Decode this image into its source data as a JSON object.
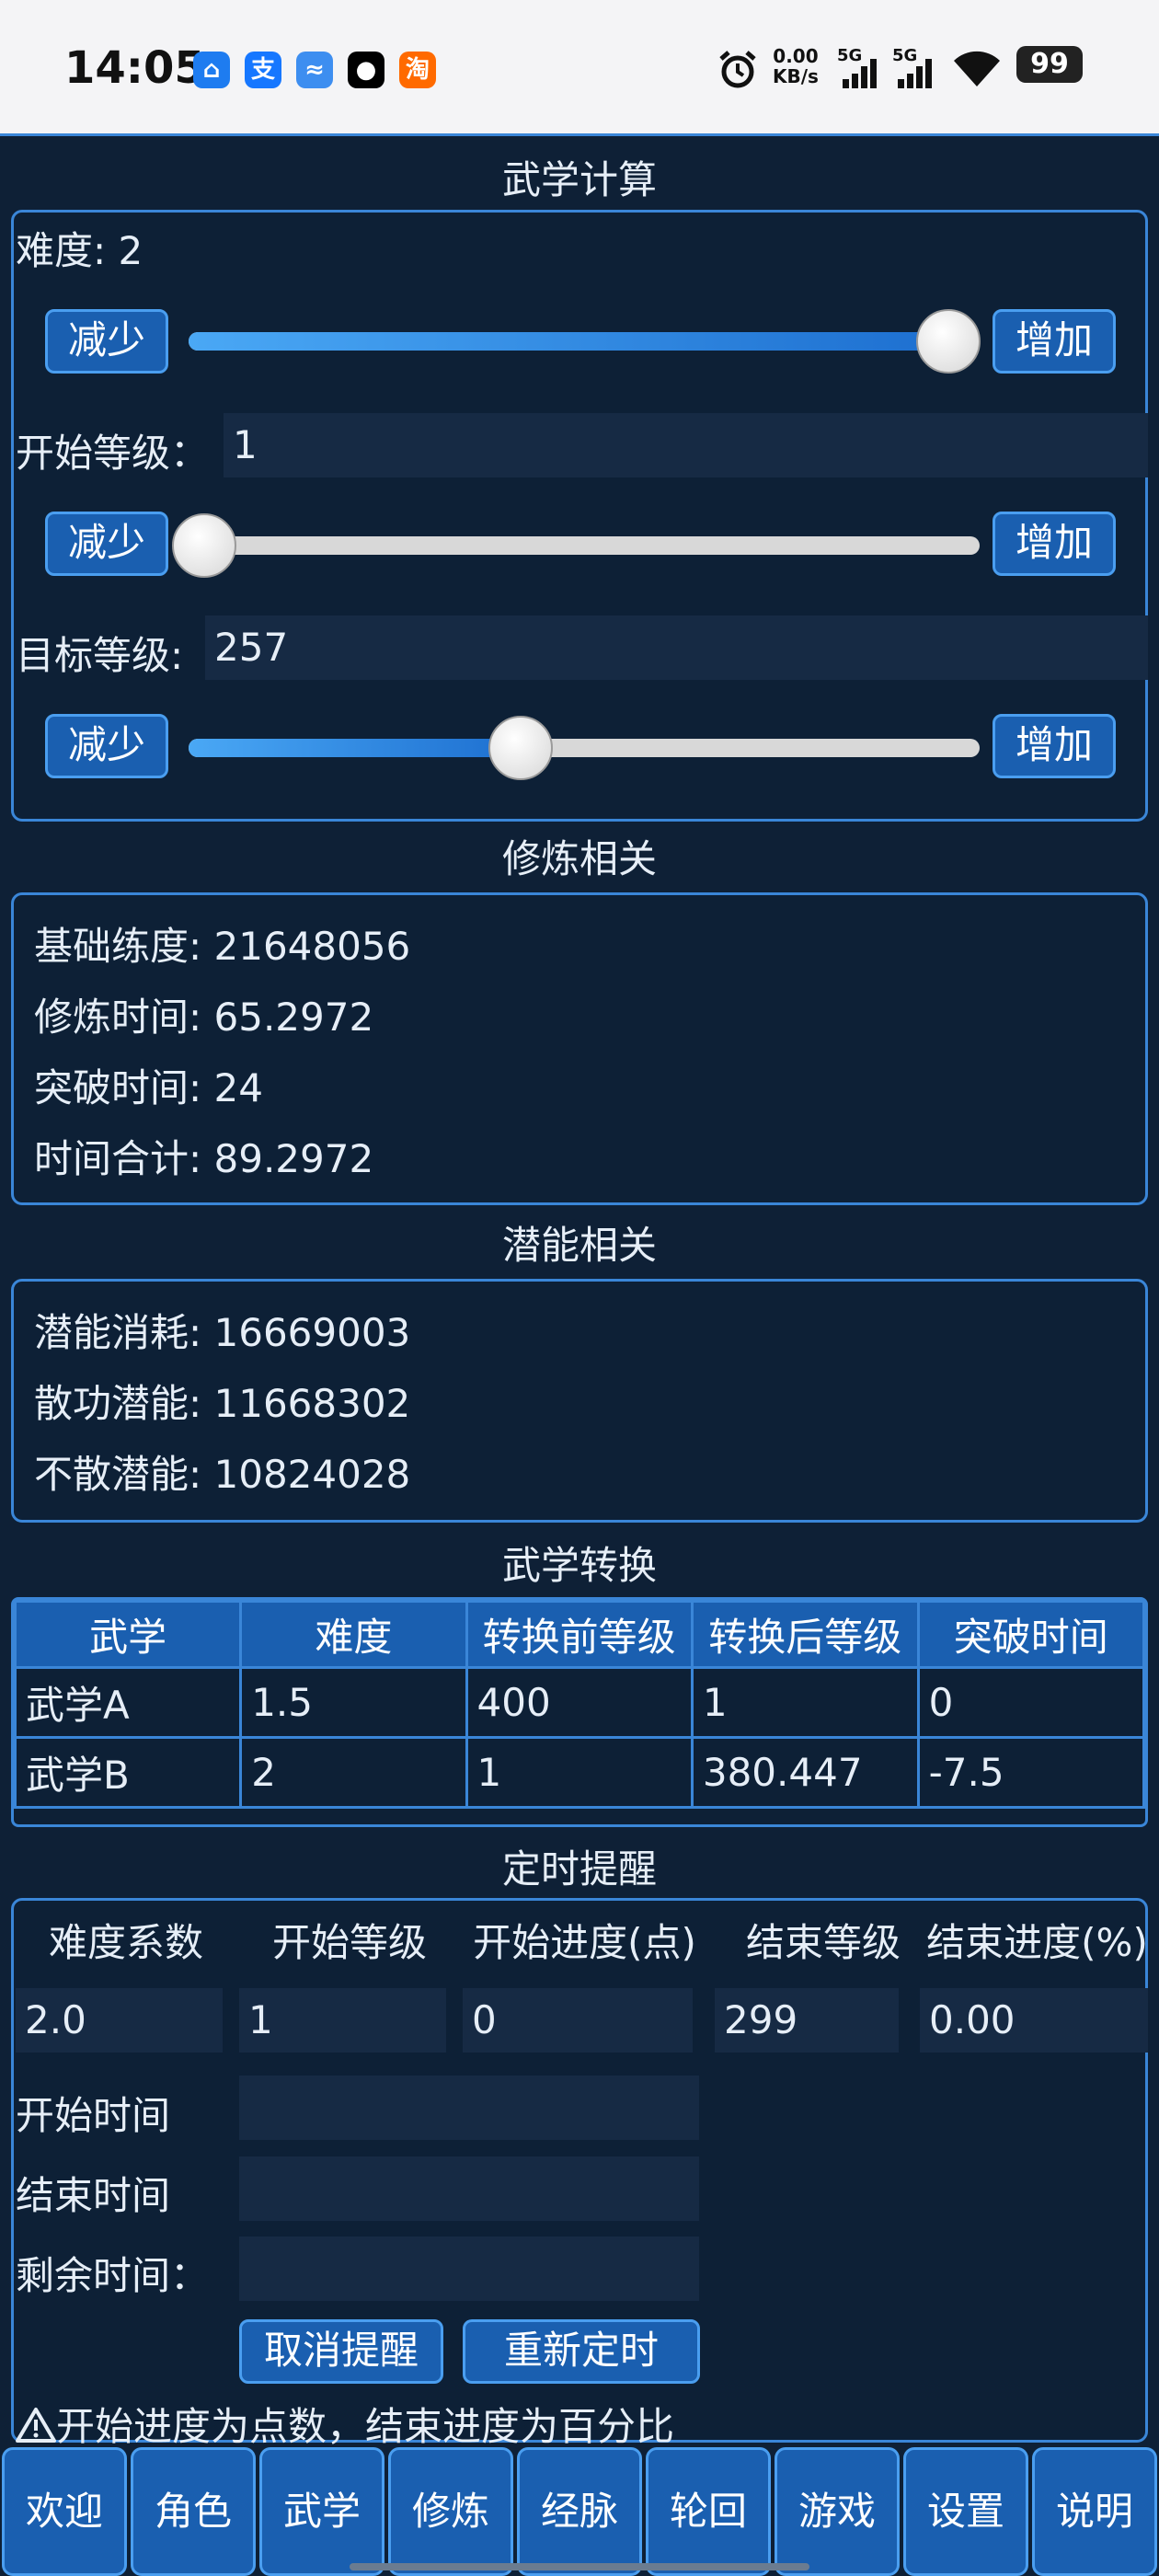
{
  "status": {
    "time": "14:05",
    "net_speed_value": "0.00",
    "net_speed_unit": "KB/s",
    "signal1_label": "5G",
    "signal2_label": "5G",
    "battery": "99",
    "app_icons": [
      {
        "name": "train-app-icon",
        "glyph": "⌂",
        "color": "#1e7cf0"
      },
      {
        "name": "alipay-icon",
        "glyph": "支",
        "color": "#1677ff"
      },
      {
        "name": "stock-app-icon",
        "glyph": "≈",
        "color": "#3d8ef0"
      },
      {
        "name": "qq-icon",
        "glyph": "●",
        "color": "#000000"
      },
      {
        "name": "taobao-flash-icon",
        "glyph": "淘",
        "color": "#ff6a00"
      }
    ]
  },
  "calc": {
    "title": "武学计算",
    "difficulty_label": "难度: ",
    "difficulty_value": "2",
    "difficulty_slider": 0.96,
    "start_level_label": "开始等级：",
    "start_level_value": "1",
    "start_slider": 0.02,
    "target_level_label": "目标等级: ",
    "target_level_value": "257",
    "target_slider": 0.42,
    "decrease_label": "减少",
    "increase_label": "增加"
  },
  "training": {
    "title": "修炼相关",
    "lines": [
      "基础练度: 21648056",
      "修炼时间: 65.2972",
      "突破时间: 24",
      "时间合计: 89.2972"
    ]
  },
  "potential": {
    "title": "潜能相关",
    "lines": [
      "潜能消耗: 16669003",
      "散功潜能: 11668302",
      "不散潜能: 10824028"
    ]
  },
  "conversion": {
    "title": "武学转换",
    "headers": [
      "武学",
      "难度",
      "转换前等级",
      "转换后等级",
      "突破时间"
    ],
    "rows": [
      [
        "武学A",
        "1.5",
        "400",
        "1",
        "0"
      ],
      [
        "武学B",
        "2",
        "1",
        "380.447",
        "-7.5"
      ]
    ]
  },
  "timer": {
    "title": "定时提醒",
    "headers": [
      "难度系数",
      "开始等级",
      "开始进度(点)",
      "结束等级",
      "结束进度(%)"
    ],
    "values": [
      "2.0",
      "1",
      "0",
      "299",
      "0.00"
    ],
    "start_time_label": "开始时间",
    "end_time_label": "结束时间",
    "remaining_label": "剩余时间：",
    "start_time_value": "",
    "end_time_value": "",
    "remaining_value": "",
    "cancel_label": "取消提醒",
    "reset_label": "重新定时",
    "note": "开始进度为点数，结束进度为百分比"
  },
  "nav": [
    "欢迎",
    "角色",
    "武学",
    "修炼",
    "经脉",
    "轮回",
    "游戏",
    "设置",
    "说明"
  ]
}
